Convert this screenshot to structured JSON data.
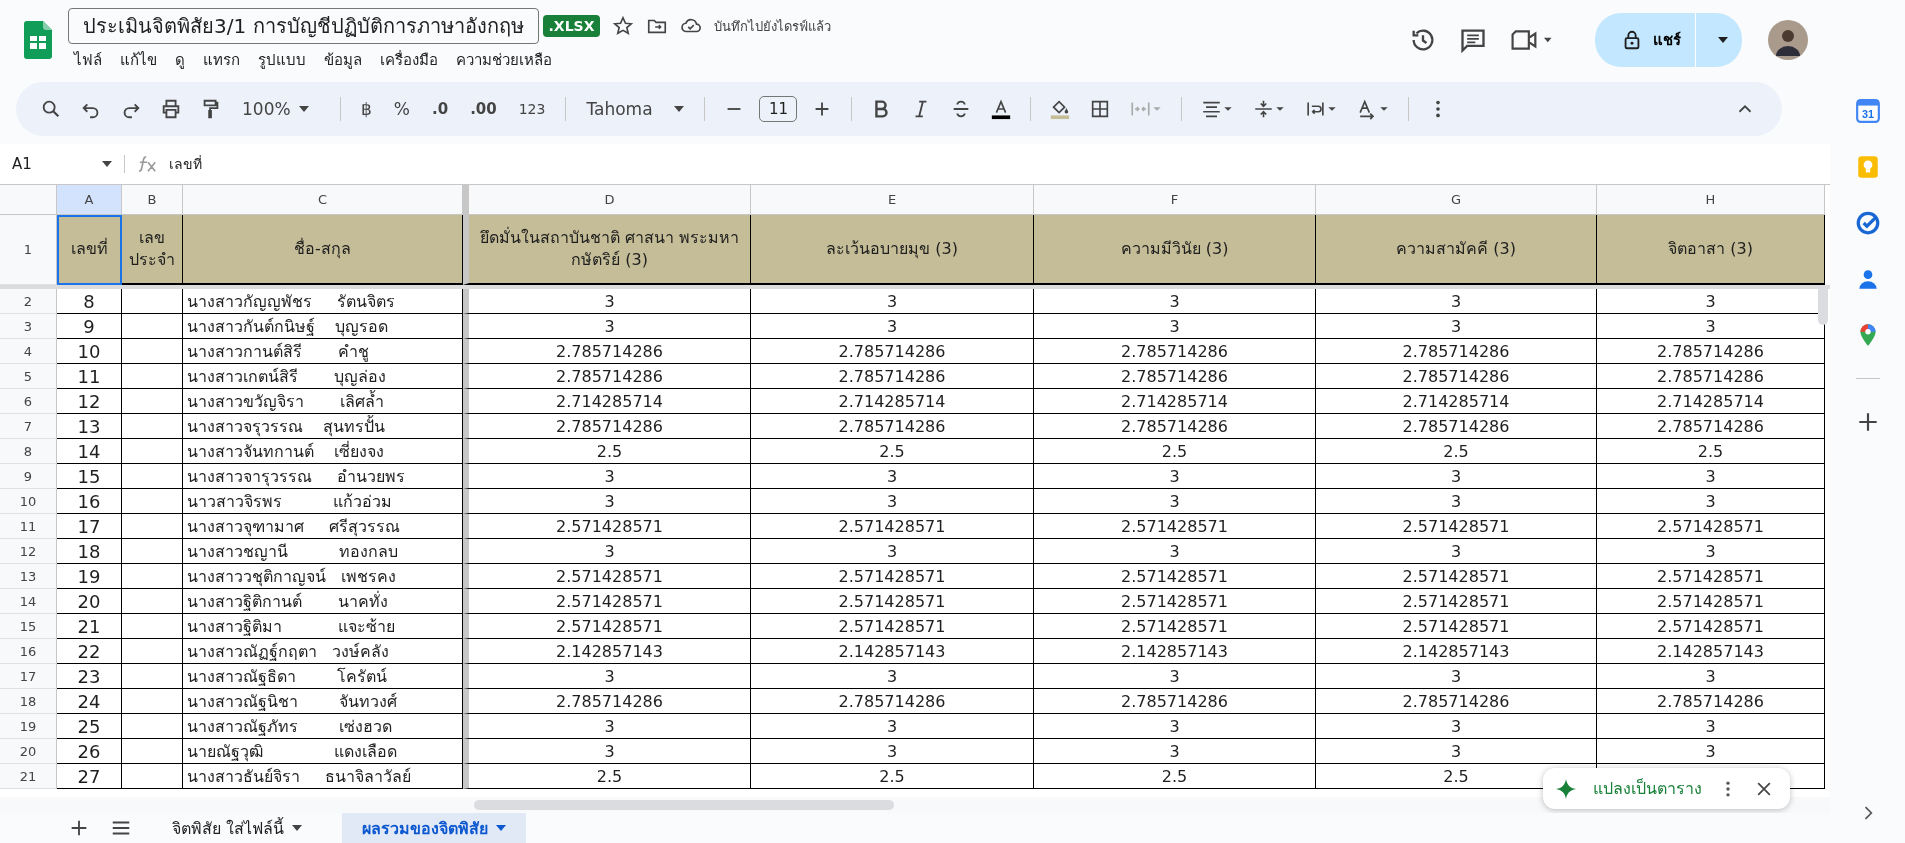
{
  "document": {
    "title": "ประเมินจิตพิสัย3/1 การบัญชีปฏิบัติการภาษาอังกฤษ",
    "badge": ".XLSX",
    "save_status": "บันทึกไปยังไดรฟ์แล้ว",
    "share": "แชร์"
  },
  "menu": [
    "ไฟล์",
    "แก้ไข",
    "ดู",
    "แทรก",
    "รูปแบบ",
    "ข้อมูล",
    "เครื่องมือ",
    "ความช่วยเหลือ"
  ],
  "toolbar": {
    "zoom": "100%",
    "currency": "฿",
    "percent": "%",
    "decimal_decrease": ".0",
    "decimal_increase": ".00",
    "number_format": "123",
    "font": "Tahoma",
    "font_size": "11"
  },
  "formula_bar": {
    "name_box": "A1",
    "value": "เลขที่"
  },
  "columns": [
    "A",
    "B",
    "C",
    "D",
    "E",
    "F",
    "G",
    "H"
  ],
  "header_row": {
    "row": "1",
    "cells": [
      {
        "text": "เลขที่",
        "selected": true
      },
      {
        "text": "เลข ประจำ",
        "selected": false
      },
      {
        "text": "ชื่อ-สกุล",
        "selected": false
      },
      {
        "text": "ยึดมั่นในสถาบันชาติ ศาสนา พระมหากษัตริย์ (3)",
        "selected": false
      },
      {
        "text": "ละเว้นอบายมุข (3)",
        "selected": false
      },
      {
        "text": "ความมีวินัย (3)",
        "selected": false
      },
      {
        "text": "ความสามัคคี (3)",
        "selected": false
      },
      {
        "text": "จิตอาสา (3)",
        "selected": false
      }
    ]
  },
  "rows": [
    {
      "row": "2",
      "no": "8",
      "name": "นางสาวกัญญพัชร     รัตนจิตร",
      "scores": [
        "3",
        "3",
        "3",
        "3",
        "3"
      ]
    },
    {
      "row": "3",
      "no": "9",
      "name": "นางสาวกันต์กนิษฐ์    บุญรอด",
      "scores": [
        "3",
        "3",
        "3",
        "3",
        "3"
      ]
    },
    {
      "row": "4",
      "no": "10",
      "name": "นางสาวกานต์สิรี       คำชู",
      "scores": [
        "2.785714286",
        "2.785714286",
        "2.785714286",
        "2.785714286",
        "2.785714286"
      ]
    },
    {
      "row": "5",
      "no": "11",
      "name": "นางสาวเกตน์สิรี       บุญล่อง",
      "scores": [
        "2.785714286",
        "2.785714286",
        "2.785714286",
        "2.785714286",
        "2.785714286"
      ]
    },
    {
      "row": "6",
      "no": "12",
      "name": "นางสาวขวัญจิรา       เลิศล้ำ",
      "scores": [
        "2.714285714",
        "2.714285714",
        "2.714285714",
        "2.714285714",
        "2.714285714"
      ]
    },
    {
      "row": "7",
      "no": "13",
      "name": "นางสาวจรุวรรณ    สุนทรปั้น",
      "scores": [
        "2.785714286",
        "2.785714286",
        "2.785714286",
        "2.785714286",
        "2.785714286"
      ]
    },
    {
      "row": "8",
      "no": "14",
      "name": "นางสาวจันทกานต์    เซี่ยงจง",
      "scores": [
        "2.5",
        "2.5",
        "2.5",
        "2.5",
        "2.5"
      ]
    },
    {
      "row": "9",
      "no": "15",
      "name": "นางสาวจารุวรรณ     อำนวยพร",
      "scores": [
        "3",
        "3",
        "3",
        "3",
        "3"
      ]
    },
    {
      "row": "10",
      "no": "16",
      "name": "นาวสาวจิรพร          แก้วอ่วม",
      "scores": [
        "3",
        "3",
        "3",
        "3",
        "3"
      ]
    },
    {
      "row": "11",
      "no": "17",
      "name": "นางสาวจุฑามาศ     ศรีสุวรรณ",
      "scores": [
        "2.571428571",
        "2.571428571",
        "2.571428571",
        "2.571428571",
        "2.571428571"
      ]
    },
    {
      "row": "12",
      "no": "18",
      "name": "นางสาวชญานี          ทองกลบ",
      "scores": [
        "3",
        "3",
        "3",
        "3",
        "3"
      ]
    },
    {
      "row": "13",
      "no": "19",
      "name": "นางสาววชุติกาญจน์   เพชรคง",
      "scores": [
        "2.571428571",
        "2.571428571",
        "2.571428571",
        "2.571428571",
        "2.571428571"
      ]
    },
    {
      "row": "14",
      "no": "20",
      "name": "นางสาวฐิติกานต์       นาคทั่ง",
      "scores": [
        "2.571428571",
        "2.571428571",
        "2.571428571",
        "2.571428571",
        "2.571428571"
      ]
    },
    {
      "row": "15",
      "no": "21",
      "name": "นางสาวฐิติมา           แจะซ้าย",
      "scores": [
        "2.571428571",
        "2.571428571",
        "2.571428571",
        "2.571428571",
        "2.571428571"
      ]
    },
    {
      "row": "16",
      "no": "22",
      "name": "นางสาวณัฏฐ์กฤตา   วงษ์คลัง",
      "scores": [
        "2.142857143",
        "2.142857143",
        "2.142857143",
        "2.142857143",
        "2.142857143"
      ]
    },
    {
      "row": "17",
      "no": "23",
      "name": "นางสาวณัฐธิดา        โครัตน์",
      "scores": [
        "3",
        "3",
        "3",
        "3",
        "3"
      ]
    },
    {
      "row": "18",
      "no": "24",
      "name": "นางสาวณัฐนิชา        จันทวงศ์",
      "scores": [
        "2.785714286",
        "2.785714286",
        "2.785714286",
        "2.785714286",
        "2.785714286"
      ]
    },
    {
      "row": "19",
      "no": "25",
      "name": "นางสาวณัฐภัทร        เซ่งฮวด",
      "scores": [
        "3",
        "3",
        "3",
        "3",
        "3"
      ]
    },
    {
      "row": "20",
      "no": "26",
      "name": "นายณัฐวุฒิ              แดงเลือด",
      "scores": [
        "3",
        "3",
        "3",
        "3",
        "3"
      ]
    },
    {
      "row": "21",
      "no": "27",
      "name": "นางสาวธันย์จิรา     ธนาจิลาวัลย์",
      "scores": [
        "2.5",
        "2.5",
        "2.5",
        "2.5"
      ]
    }
  ],
  "sheet_tabs": [
    {
      "label": "จิตพิสัย ใส่ไฟล์นี้",
      "selected": false
    },
    {
      "label": "ผลรวมของจิตพิสัย",
      "selected": true
    }
  ],
  "popup": {
    "label": "แปลงเป็นตาราง"
  },
  "side_panel": {
    "calendar_day": "31"
  }
}
